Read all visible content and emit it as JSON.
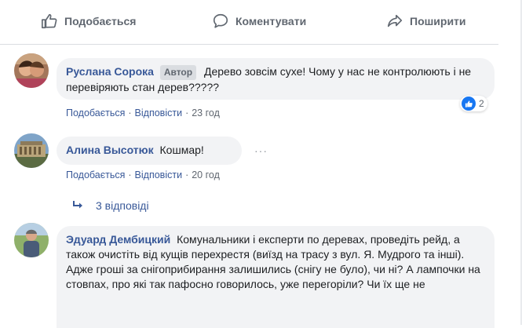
{
  "actions": {
    "like": "Подобається",
    "comment": "Коментувати",
    "share": "Поширити"
  },
  "comments": [
    {
      "author": "Руслана Сорока",
      "badge": "Автор",
      "text": "Дерево зовсім сухе! Чому у нас не контролюють і не перевіряють стан дерев?????",
      "like_label": "Подобається",
      "reply_label": "Відповісти",
      "time": "23 год",
      "reactions": "2"
    },
    {
      "author": "Алина Высотюк",
      "text": "Кошмар!",
      "like_label": "Подобається",
      "reply_label": "Відповісти",
      "time": "20 год",
      "more": "···",
      "replies": "3 відповіді"
    },
    {
      "author": "Эдуард Дембицкий",
      "text": "Комунальники і експерти по деревах, проведіть рейд, а також очистіть від кущів перехрестя (виїзд на трасу з вул. Я. Мудрого та інші). Адже гроші за снігоприбирання залишились (снігу не було), чи ні? А лампочки на стовпах, про які так пафосно говорилось, уже перегоріли? Чи їх ще не"
    }
  ],
  "colors": {
    "link": "#385898",
    "bubble": "#f2f3f5",
    "meta": "#606770",
    "like_blue": "#1877f2"
  }
}
